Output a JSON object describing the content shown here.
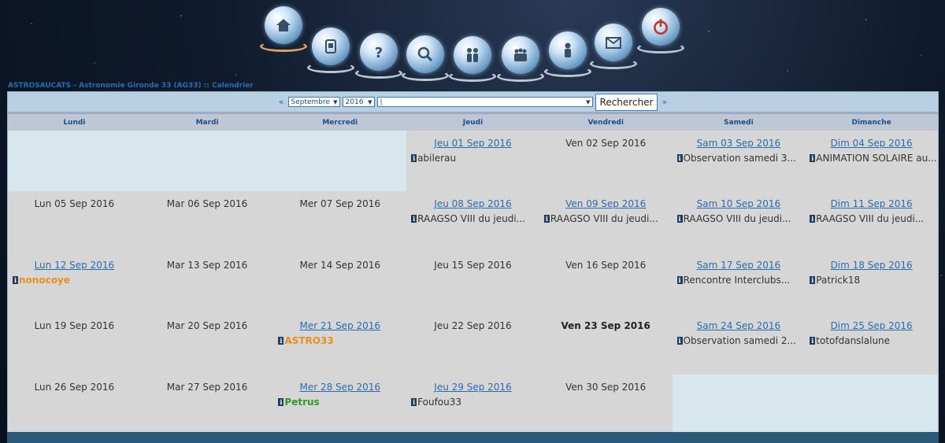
{
  "nav": {
    "icons": [
      "home-icon",
      "register-icon",
      "help-icon",
      "search-icon",
      "members-icon",
      "groups-icon",
      "profile-icon",
      "messages-icon",
      "logout-icon"
    ]
  },
  "breadcrumb": "ASTROSAUCATS - Astronomie Gironde 33 (AG33) :: Calendrier",
  "controls": {
    "prev": "«",
    "next": "»",
    "month": "Septembre",
    "year": "2016",
    "group": "|",
    "search_label": "Rechercher"
  },
  "weekdays": [
    "Lundi",
    "Mardi",
    "Mercredi",
    "Jeudi",
    "Vendredi",
    "Samedi",
    "Dimanche"
  ],
  "colors": {
    "link": "#2b6cb0",
    "orange_user": "#e8901c",
    "green_user": "#2e9a2e"
  },
  "weeks": [
    [
      {
        "empty": true
      },
      {
        "empty": true
      },
      {
        "empty": true
      },
      {
        "date": "Jeu 01 Sep 2016",
        "link": true,
        "events": [
          {
            "text": "abilerau"
          }
        ]
      },
      {
        "date": "Ven 02 Sep 2016"
      },
      {
        "date": "Sam 03 Sep 2016",
        "link": true,
        "events": [
          {
            "text": "Observation samedi 3..."
          }
        ]
      },
      {
        "date": "Dim 04 Sep 2016",
        "link": true,
        "events": [
          {
            "text": "ANIMATION SOLAIRE au..."
          }
        ]
      }
    ],
    [
      {
        "date": "Lun 05 Sep 2016"
      },
      {
        "date": "Mar 06 Sep 2016"
      },
      {
        "date": "Mer 07 Sep 2016"
      },
      {
        "date": "Jeu 08 Sep 2016",
        "link": true,
        "events": [
          {
            "text": "RAAGSO VIII du jeudi..."
          }
        ]
      },
      {
        "date": "Ven 09 Sep 2016",
        "link": true,
        "events": [
          {
            "text": "RAAGSO VIII du jeudi..."
          }
        ]
      },
      {
        "date": "Sam 10 Sep 2016",
        "link": true,
        "events": [
          {
            "text": "RAAGSO VIII du jeudi..."
          }
        ]
      },
      {
        "date": "Dim 11 Sep 2016",
        "link": true,
        "events": [
          {
            "text": "RAAGSO VIII du jeudi..."
          }
        ]
      }
    ],
    [
      {
        "date": "Lun 12 Sep 2016",
        "link": true,
        "events": [
          {
            "text": "nonocoye",
            "style": "orange"
          }
        ]
      },
      {
        "date": "Mar 13 Sep 2016"
      },
      {
        "date": "Mer 14 Sep 2016"
      },
      {
        "date": "Jeu 15 Sep 2016"
      },
      {
        "date": "Ven 16 Sep 2016"
      },
      {
        "date": "Sam 17 Sep 2016",
        "link": true,
        "events": [
          {
            "text": "Rencontre Interclubs..."
          }
        ]
      },
      {
        "date": "Dim 18 Sep 2016",
        "link": true,
        "events": [
          {
            "text": "Patrick18"
          }
        ]
      }
    ],
    [
      {
        "date": "Lun 19 Sep 2016"
      },
      {
        "date": "Mar 20 Sep 2016"
      },
      {
        "date": "Mer 21 Sep 2016",
        "link": true,
        "events": [
          {
            "text": "ASTRO33",
            "style": "orange"
          }
        ]
      },
      {
        "date": "Jeu 22 Sep 2016"
      },
      {
        "date": "Ven 23 Sep 2016",
        "today": true
      },
      {
        "date": "Sam 24 Sep 2016",
        "link": true,
        "events": [
          {
            "text": "Observation samedi 2..."
          }
        ]
      },
      {
        "date": "Dim 25 Sep 2016",
        "link": true,
        "events": [
          {
            "text": "totofdanslalune"
          }
        ]
      }
    ],
    [
      {
        "date": "Lun 26 Sep 2016"
      },
      {
        "date": "Mar 27 Sep 2016"
      },
      {
        "date": "Mer 28 Sep 2016",
        "link": true,
        "events": [
          {
            "text": "Petrus",
            "style": "green"
          }
        ]
      },
      {
        "date": "Jeu 29 Sep 2016",
        "link": true,
        "events": [
          {
            "text": "Foufou33"
          }
        ]
      },
      {
        "date": "Ven 30 Sep 2016"
      },
      {
        "empty": true
      },
      {
        "empty": true
      }
    ]
  ]
}
